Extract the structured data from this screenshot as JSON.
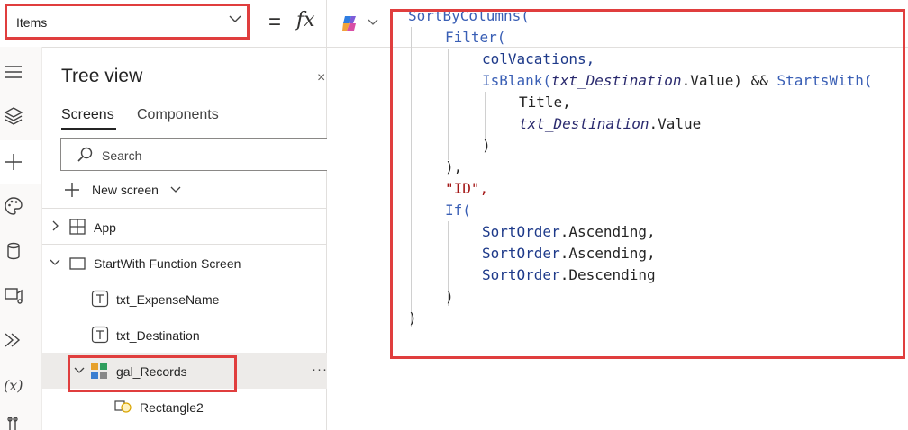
{
  "formula_bar": {
    "property": "Items",
    "equals": "=",
    "fx": "fx"
  },
  "tree": {
    "title": "Tree view",
    "close": "×",
    "tabs": [
      "Screens",
      "Components"
    ],
    "search_placeholder": "Search",
    "new_screen": "New screen",
    "items": {
      "app": "App",
      "screen": "StartWith Function Screen",
      "txt_expense": "txt_ExpenseName",
      "txt_destination": "txt_Destination",
      "gallery": "gal_Records",
      "rectangle": "Rectangle2"
    },
    "more": "···"
  },
  "code": {
    "l1": "SortByColumns(",
    "l2a": "Filter(",
    "l3": "colVacations,",
    "l4_isblank": "IsBlank(",
    "l4_param": "txt_Destination",
    "l4_rest": ".Value) && ",
    "l4_starts": "StartsWith(",
    "l5": "Title,",
    "l6_param": "txt_Destination",
    "l6_rest": ".Value",
    "l7": ")",
    "l8": "),",
    "l9": "\"ID\",",
    "l10": "If(",
    "l11_var": "SortOrder",
    "l11_rest": ".Ascending,",
    "l12_var": "SortOrder",
    "l12_rest": ".Ascending,",
    "l13_var": "SortOrder",
    "l13_rest": ".Descending",
    "l14": ")",
    "l15": ")"
  },
  "colors": {
    "highlight": "#e03e3e",
    "function": "#3a5fb5",
    "string": "#a31515"
  }
}
